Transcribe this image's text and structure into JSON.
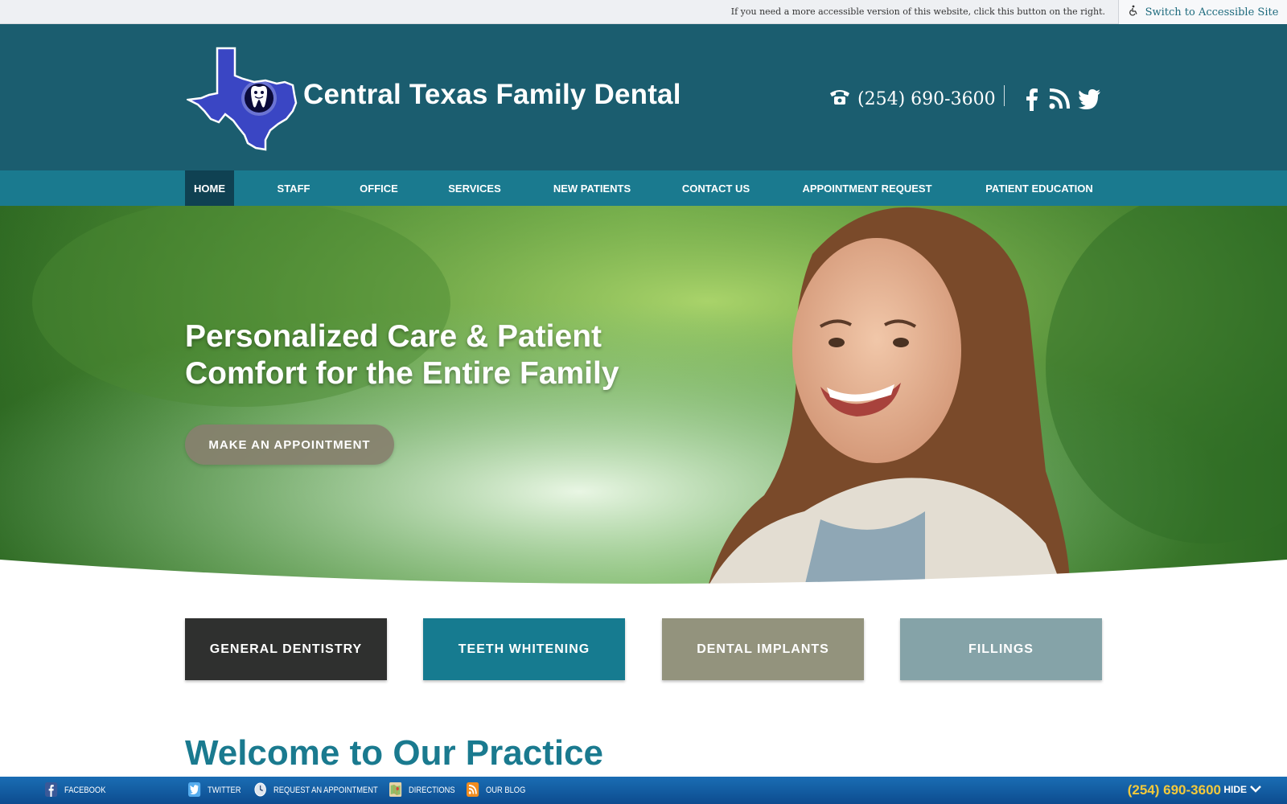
{
  "accessibility": {
    "notice": "If you need a more accessible version of this website, click this button on the right.",
    "button_label": "Switch to Accessible Site"
  },
  "header": {
    "logo_text": "Central Texas Family Dental",
    "phone": "(254) 690-3600",
    "social": [
      "facebook-icon",
      "rss-icon",
      "twitter-icon"
    ]
  },
  "nav": {
    "items": [
      {
        "label": "HOME"
      },
      {
        "label": "STAFF"
      },
      {
        "label": "OFFICE"
      },
      {
        "label": "SERVICES"
      },
      {
        "label": "NEW PATIENTS"
      },
      {
        "label": "CONTACT US"
      },
      {
        "label": "APPOINTMENT REQUEST"
      },
      {
        "label": "PATIENT EDUCATION"
      }
    ],
    "active": "HOME"
  },
  "hero": {
    "title_line1": "Personalized Care & Patient",
    "title_line2": "Comfort for the Entire Family",
    "cta_label": "MAKE AN APPOINTMENT"
  },
  "services": {
    "tiles": [
      {
        "label": "GENERAL DENTISTRY",
        "color": "#2f302f"
      },
      {
        "label": "TEETH WHITENING",
        "color": "#167b90"
      },
      {
        "label": "DENTAL IMPLANTS",
        "color": "#93937d"
      },
      {
        "label": "FILLINGS",
        "color": "#85a3a8"
      }
    ]
  },
  "welcome": {
    "heading": "Welcome to Our Practice"
  },
  "bottom_bar": {
    "items": [
      {
        "label": "FACEBOOK"
      },
      {
        "label": "TWITTER"
      },
      {
        "label": "REQUEST AN APPOINTMENT"
      },
      {
        "label": "DIRECTIONS"
      },
      {
        "label": "OUR BLOG"
      }
    ],
    "phone": "(254) 690-3600",
    "hide_label": "HIDE"
  },
  "colors": {
    "header_bg": "#1b5d6f",
    "nav_bg": "#1a7a8f",
    "nav_active": "#0f4152",
    "accent": "#1a7a8f",
    "bottom_phone": "#f3c93b"
  }
}
